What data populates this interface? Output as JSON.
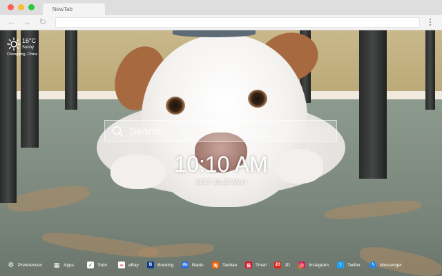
{
  "browser": {
    "tab_title": "NewTab",
    "back_glyph": "←",
    "forward_glyph": "→",
    "reload_glyph": "↻"
  },
  "weather": {
    "icon": "sun-icon",
    "temperature": "16°C",
    "condition": "Sunny",
    "location": "Chongqing,  China"
  },
  "search": {
    "placeholder": "Search"
  },
  "clock": {
    "time": "10:10 AM",
    "date": "2017.10.30 Mon"
  },
  "bottom_bar": {
    "items": [
      {
        "label": "Preferences",
        "icon": "gear-icon",
        "color": "#ffffff"
      },
      {
        "label": "Apps",
        "icon": "grid-icon",
        "color": "#ffffff"
      },
      {
        "label": "Todo",
        "icon": "checkbox-icon",
        "color": "#ffffff"
      },
      {
        "label": "eBay",
        "icon": "ebay-icon",
        "color": "#ffffff"
      },
      {
        "label": "Booking",
        "icon": "booking-icon",
        "color": "#0b3b8c"
      },
      {
        "label": "Baidu",
        "icon": "baidu-icon",
        "color": "#2f6fe0"
      },
      {
        "label": "Taobao",
        "icon": "taobao-icon",
        "color": "#ff5a00"
      },
      {
        "label": "Tmall",
        "icon": "tmall-icon",
        "color": "#e0102a"
      },
      {
        "label": "JD",
        "icon": "jd-icon",
        "color": "#e1251b"
      },
      {
        "label": "Instagram",
        "icon": "instagram-icon",
        "color": "#d6249f"
      },
      {
        "label": "Twitter",
        "icon": "twitter-icon",
        "color": "#1da1f2"
      },
      {
        "label": "Messenger",
        "icon": "messenger-icon",
        "color": "#1e88e5"
      }
    ]
  }
}
